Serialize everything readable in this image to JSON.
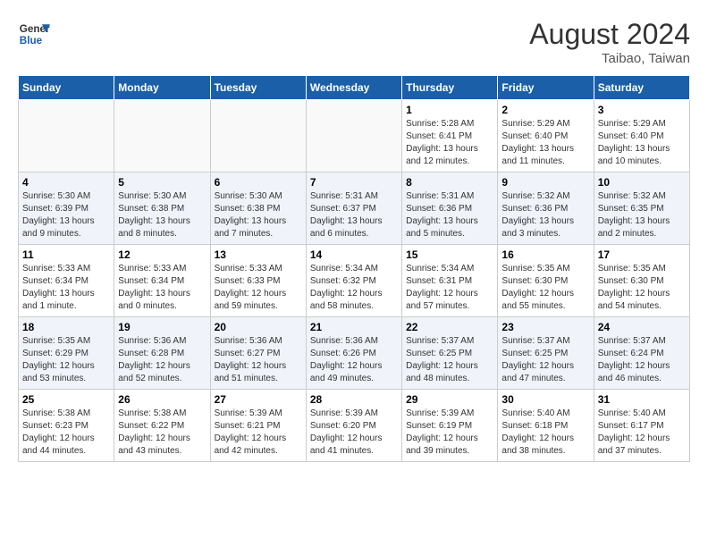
{
  "header": {
    "logo_line1": "General",
    "logo_line2": "Blue",
    "month_year": "August 2024",
    "location": "Taibao, Taiwan"
  },
  "weekdays": [
    "Sunday",
    "Monday",
    "Tuesday",
    "Wednesday",
    "Thursday",
    "Friday",
    "Saturday"
  ],
  "weeks": [
    [
      {
        "day": "",
        "info": ""
      },
      {
        "day": "",
        "info": ""
      },
      {
        "day": "",
        "info": ""
      },
      {
        "day": "",
        "info": ""
      },
      {
        "day": "1",
        "info": "Sunrise: 5:28 AM\nSunset: 6:41 PM\nDaylight: 13 hours\nand 12 minutes."
      },
      {
        "day": "2",
        "info": "Sunrise: 5:29 AM\nSunset: 6:40 PM\nDaylight: 13 hours\nand 11 minutes."
      },
      {
        "day": "3",
        "info": "Sunrise: 5:29 AM\nSunset: 6:40 PM\nDaylight: 13 hours\nand 10 minutes."
      }
    ],
    [
      {
        "day": "4",
        "info": "Sunrise: 5:30 AM\nSunset: 6:39 PM\nDaylight: 13 hours\nand 9 minutes."
      },
      {
        "day": "5",
        "info": "Sunrise: 5:30 AM\nSunset: 6:38 PM\nDaylight: 13 hours\nand 8 minutes."
      },
      {
        "day": "6",
        "info": "Sunrise: 5:30 AM\nSunset: 6:38 PM\nDaylight: 13 hours\nand 7 minutes."
      },
      {
        "day": "7",
        "info": "Sunrise: 5:31 AM\nSunset: 6:37 PM\nDaylight: 13 hours\nand 6 minutes."
      },
      {
        "day": "8",
        "info": "Sunrise: 5:31 AM\nSunset: 6:36 PM\nDaylight: 13 hours\nand 5 minutes."
      },
      {
        "day": "9",
        "info": "Sunrise: 5:32 AM\nSunset: 6:36 PM\nDaylight: 13 hours\nand 3 minutes."
      },
      {
        "day": "10",
        "info": "Sunrise: 5:32 AM\nSunset: 6:35 PM\nDaylight: 13 hours\nand 2 minutes."
      }
    ],
    [
      {
        "day": "11",
        "info": "Sunrise: 5:33 AM\nSunset: 6:34 PM\nDaylight: 13 hours\nand 1 minute."
      },
      {
        "day": "12",
        "info": "Sunrise: 5:33 AM\nSunset: 6:34 PM\nDaylight: 13 hours\nand 0 minutes."
      },
      {
        "day": "13",
        "info": "Sunrise: 5:33 AM\nSunset: 6:33 PM\nDaylight: 12 hours\nand 59 minutes."
      },
      {
        "day": "14",
        "info": "Sunrise: 5:34 AM\nSunset: 6:32 PM\nDaylight: 12 hours\nand 58 minutes."
      },
      {
        "day": "15",
        "info": "Sunrise: 5:34 AM\nSunset: 6:31 PM\nDaylight: 12 hours\nand 57 minutes."
      },
      {
        "day": "16",
        "info": "Sunrise: 5:35 AM\nSunset: 6:30 PM\nDaylight: 12 hours\nand 55 minutes."
      },
      {
        "day": "17",
        "info": "Sunrise: 5:35 AM\nSunset: 6:30 PM\nDaylight: 12 hours\nand 54 minutes."
      }
    ],
    [
      {
        "day": "18",
        "info": "Sunrise: 5:35 AM\nSunset: 6:29 PM\nDaylight: 12 hours\nand 53 minutes."
      },
      {
        "day": "19",
        "info": "Sunrise: 5:36 AM\nSunset: 6:28 PM\nDaylight: 12 hours\nand 52 minutes."
      },
      {
        "day": "20",
        "info": "Sunrise: 5:36 AM\nSunset: 6:27 PM\nDaylight: 12 hours\nand 51 minutes."
      },
      {
        "day": "21",
        "info": "Sunrise: 5:36 AM\nSunset: 6:26 PM\nDaylight: 12 hours\nand 49 minutes."
      },
      {
        "day": "22",
        "info": "Sunrise: 5:37 AM\nSunset: 6:25 PM\nDaylight: 12 hours\nand 48 minutes."
      },
      {
        "day": "23",
        "info": "Sunrise: 5:37 AM\nSunset: 6:25 PM\nDaylight: 12 hours\nand 47 minutes."
      },
      {
        "day": "24",
        "info": "Sunrise: 5:37 AM\nSunset: 6:24 PM\nDaylight: 12 hours\nand 46 minutes."
      }
    ],
    [
      {
        "day": "25",
        "info": "Sunrise: 5:38 AM\nSunset: 6:23 PM\nDaylight: 12 hours\nand 44 minutes."
      },
      {
        "day": "26",
        "info": "Sunrise: 5:38 AM\nSunset: 6:22 PM\nDaylight: 12 hours\nand 43 minutes."
      },
      {
        "day": "27",
        "info": "Sunrise: 5:39 AM\nSunset: 6:21 PM\nDaylight: 12 hours\nand 42 minutes."
      },
      {
        "day": "28",
        "info": "Sunrise: 5:39 AM\nSunset: 6:20 PM\nDaylight: 12 hours\nand 41 minutes."
      },
      {
        "day": "29",
        "info": "Sunrise: 5:39 AM\nSunset: 6:19 PM\nDaylight: 12 hours\nand 39 minutes."
      },
      {
        "day": "30",
        "info": "Sunrise: 5:40 AM\nSunset: 6:18 PM\nDaylight: 12 hours\nand 38 minutes."
      },
      {
        "day": "31",
        "info": "Sunrise: 5:40 AM\nSunset: 6:17 PM\nDaylight: 12 hours\nand 37 minutes."
      }
    ]
  ]
}
